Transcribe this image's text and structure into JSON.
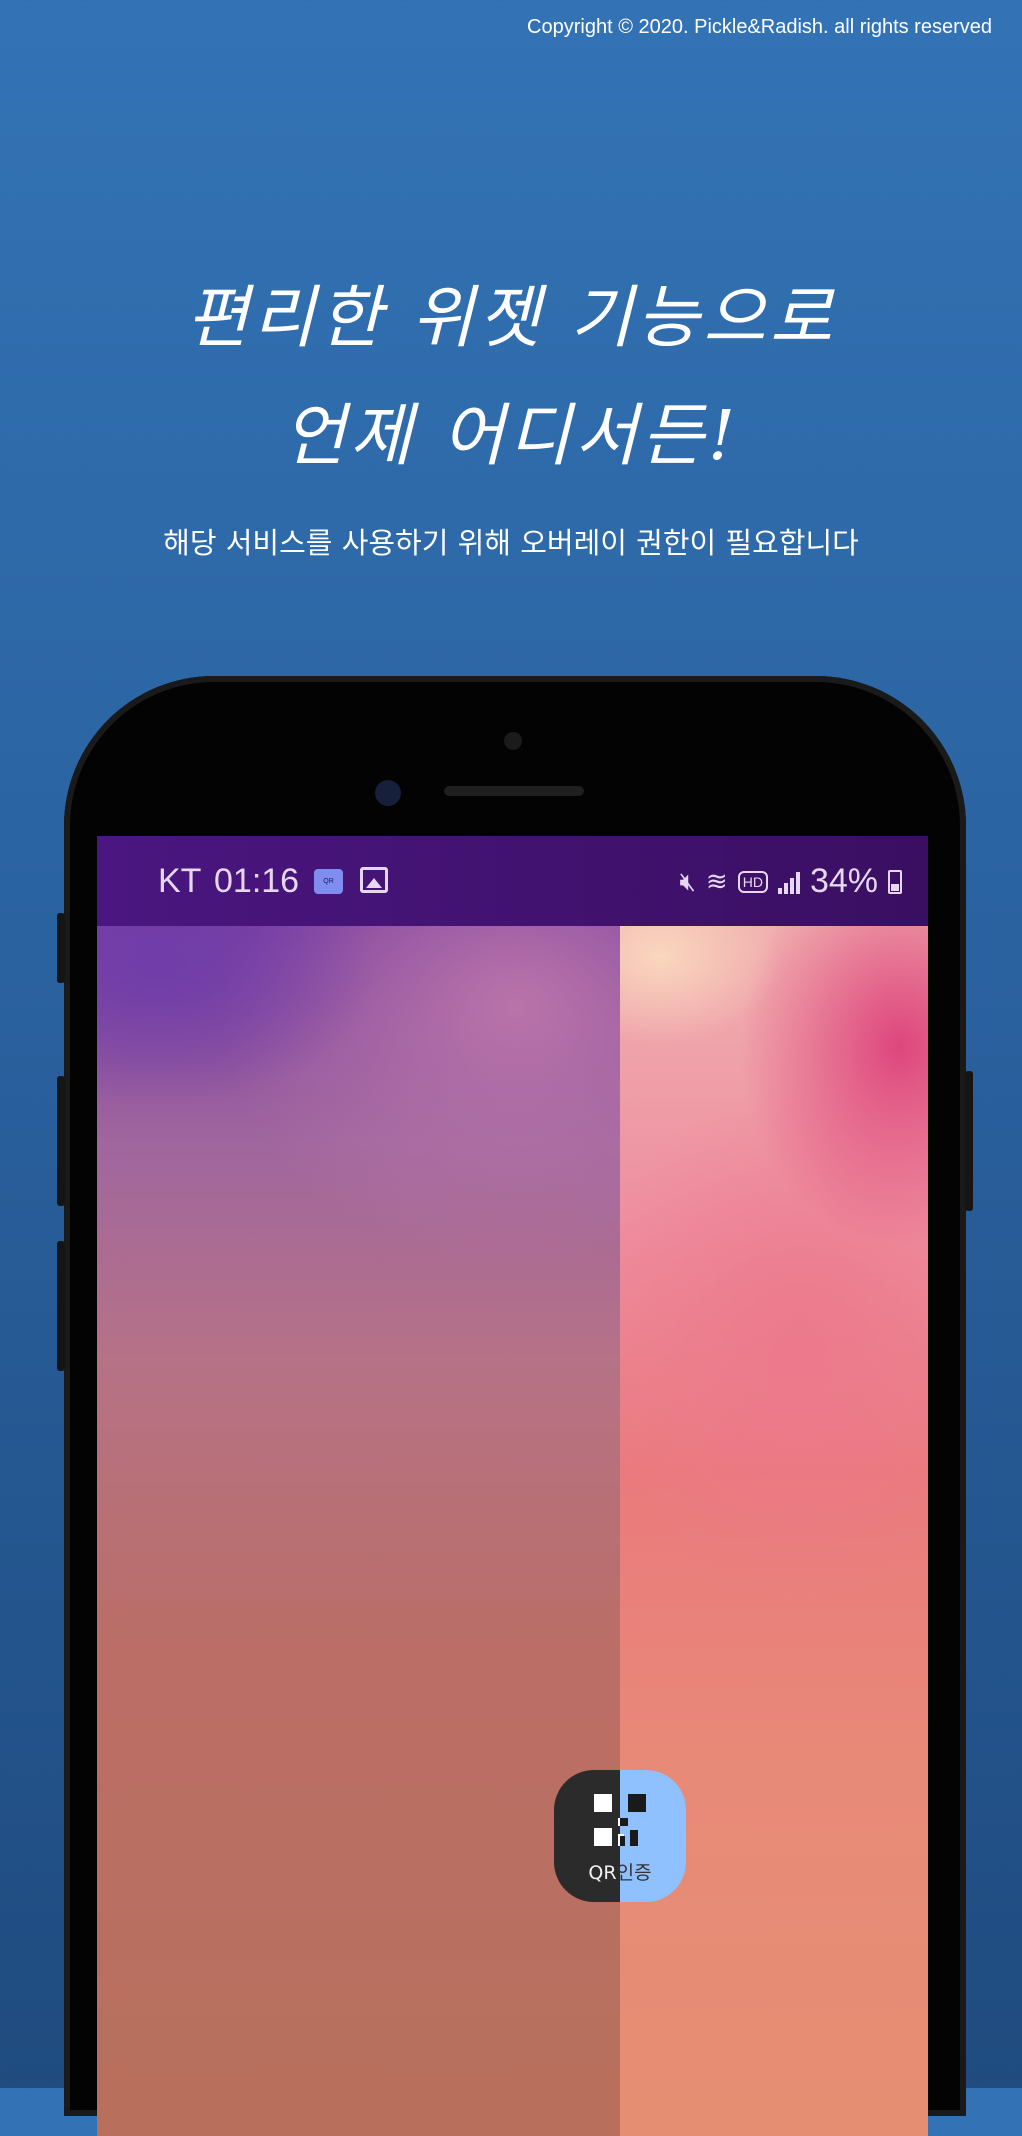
{
  "copyright": "Copyright © 2020. Pickle&Radish. all rights reserved",
  "headline": {
    "line1": "편리한 위젯 기능으로",
    "line2": "언제 어디서든!"
  },
  "subtext": "해당 서비스를 사용하기 위해 오버레이 권한이 필요합니다",
  "status_bar": {
    "carrier": "KT",
    "time": "01:16",
    "notification_icons": [
      "qr-icon",
      "image-icon"
    ],
    "system_icons": [
      "mute-icon",
      "wifi-icon",
      "hd-icon",
      "signal-icon",
      "battery-icon"
    ],
    "battery": "34%"
  },
  "widget": {
    "label_left": "QR",
    "label_right": "인증",
    "icon": "qr-code-icon",
    "colors": {
      "dark": "#2b2b2b",
      "light": "#8fc0ff"
    }
  },
  "colors": {
    "background": "#2f6aad",
    "status_bar": "#451478"
  }
}
